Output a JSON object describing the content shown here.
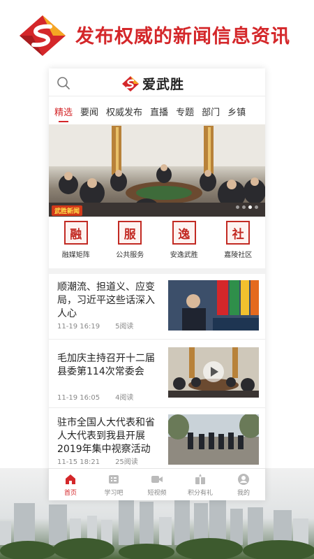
{
  "promo": {
    "tagline": "发布权威的新闻信息资讯"
  },
  "app": {
    "name": "爱武胜"
  },
  "tabs": [
    "精选",
    "要闻",
    "权威发布",
    "直播",
    "专题",
    "部门",
    "乡镇"
  ],
  "hero": {
    "badge": "武胜新闻"
  },
  "services": [
    {
      "label": "融媒矩阵",
      "glyph": "融",
      "icon": "seal-rong-icon"
    },
    {
      "label": "公共服务",
      "glyph": "服",
      "icon": "seal-fu-icon"
    },
    {
      "label": "安逸武胜",
      "glyph": "逸",
      "icon": "seal-yi-icon"
    },
    {
      "label": "嘉陵社区",
      "glyph": "社",
      "icon": "seal-she-icon"
    }
  ],
  "news": [
    {
      "title": "顺潮流、担道义、应变局，习近平这些话深入人心",
      "time": "11-19 16:19",
      "reads": "5阅读"
    },
    {
      "title": "毛加庆主持召开十二届县委第114次常委会",
      "time": "11-19 16:05",
      "reads": "4阅读"
    },
    {
      "title": "驻市全国人大代表和省人大代表到我县开展2019年集中视察活动",
      "time": "11-15 18:21",
      "reads": "25阅读"
    }
  ],
  "bottom_nav": [
    {
      "label": "首页",
      "icon": "home-icon"
    },
    {
      "label": "学习吧",
      "icon": "study-icon"
    },
    {
      "label": "短视频",
      "icon": "video-icon"
    },
    {
      "label": "积分有礼",
      "icon": "gift-icon"
    },
    {
      "label": "我的",
      "icon": "profile-icon"
    }
  ],
  "colors": {
    "brand_red": "#d4272a",
    "seal_red": "#c22a23"
  }
}
